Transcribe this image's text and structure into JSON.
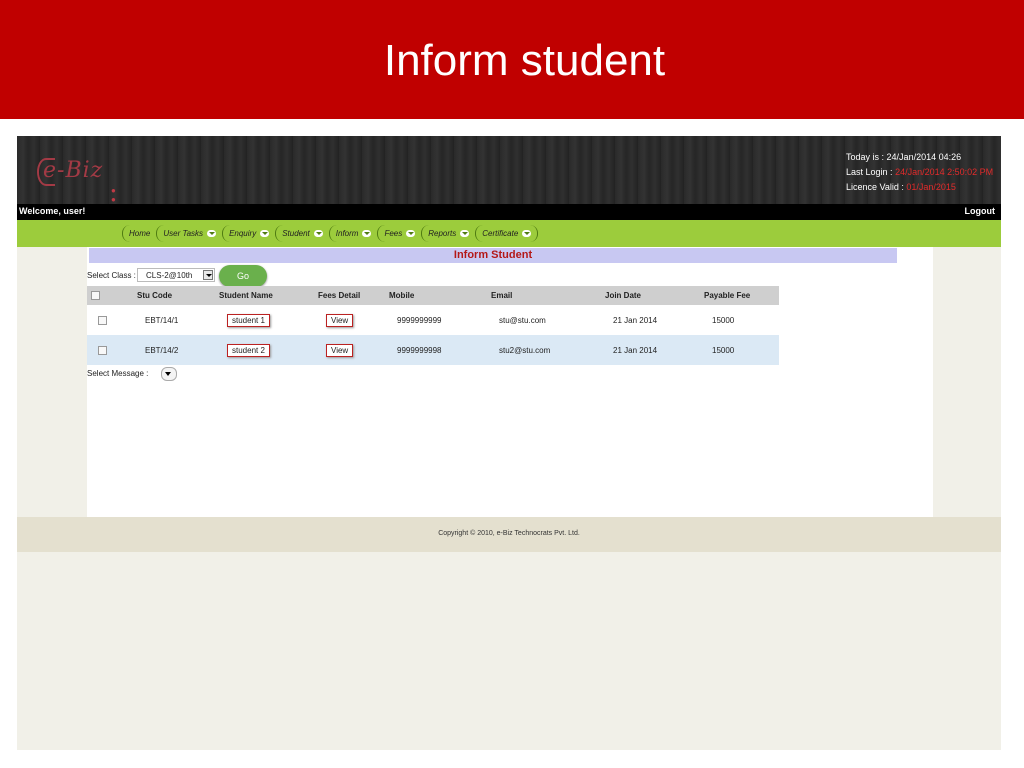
{
  "slide": {
    "title": "Inform student"
  },
  "header": {
    "logo_text": "e-Biz",
    "today_label": "Today is :",
    "today_value": "24/Jan/2014 04:26",
    "last_login_label": "Last Login :",
    "last_login_value": "24/Jan/2014 2:50:02 PM",
    "licence_label": "Licence Valid :",
    "licence_value": "01/Jan/2015"
  },
  "userbar": {
    "welcome": "Welcome,  user!",
    "logout": "Logout"
  },
  "nav": {
    "items": [
      {
        "label": "Home",
        "dropdown": false
      },
      {
        "label": "User Tasks",
        "dropdown": true
      },
      {
        "label": "Enquiry",
        "dropdown": true
      },
      {
        "label": "Student",
        "dropdown": true
      },
      {
        "label": "Inform",
        "dropdown": true
      },
      {
        "label": "Fees",
        "dropdown": true
      },
      {
        "label": "Reports",
        "dropdown": true
      },
      {
        "label": "Certificate",
        "dropdown": true
      }
    ]
  },
  "page": {
    "title": "Inform Student",
    "select_class_label": "Select Class :",
    "select_class_value": "CLS-2@10th",
    "go_label": "Go",
    "select_message_label": "Select Message :"
  },
  "table": {
    "headers": [
      "Stu Code",
      "Student Name",
      "Fees Detail",
      "Mobile",
      "Email",
      "Join Date",
      "Payable Fee"
    ],
    "rows": [
      {
        "code": "EBT/14/1",
        "name": "student 1",
        "fees": "View",
        "mobile": "9999999999",
        "email": "stu@stu.com",
        "join": "21 Jan 2014",
        "fee": "15000"
      },
      {
        "code": "EBT/14/2",
        "name": "student 2",
        "fees": "View",
        "mobile": "9999999998",
        "email": "stu2@stu.com",
        "join": "21 Jan 2014",
        "fee": "15000"
      }
    ]
  },
  "footer": {
    "copyright": "Copyright © 2010, e-Biz Technocrats Pvt. Ltd."
  }
}
